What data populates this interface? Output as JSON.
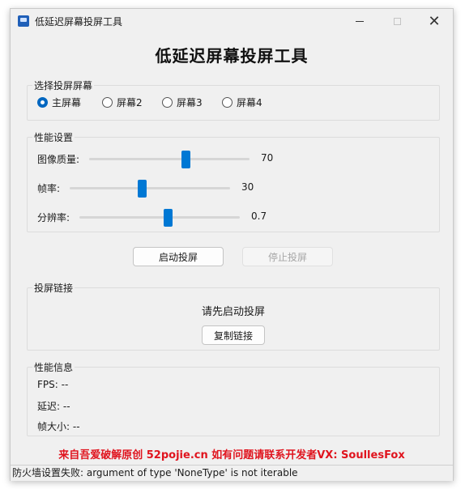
{
  "window": {
    "title": "低延迟屏幕投屏工具",
    "minimize": "—",
    "close": "✕"
  },
  "main_title": "低延迟屏幕投屏工具",
  "screen_group": {
    "title": "选择投屏屏幕",
    "options": [
      {
        "label": "主屏幕",
        "selected": true
      },
      {
        "label": "屏幕2",
        "selected": false
      },
      {
        "label": "屏幕3",
        "selected": false
      },
      {
        "label": "屏幕4",
        "selected": false
      }
    ]
  },
  "perf_group": {
    "title": "性能设置",
    "sliders": [
      {
        "label": "图像质量:",
        "value": "70",
        "fraction": 0.6
      },
      {
        "label": "帧率:",
        "value": "30",
        "fraction": 0.45
      },
      {
        "label": "分辨率:",
        "value": "0.7",
        "fraction": 0.55
      }
    ]
  },
  "buttons": {
    "start": "启动投屏",
    "stop": "停止投屏"
  },
  "link_group": {
    "title": "投屏链接",
    "status": "请先启动投屏",
    "copy_button": "复制链接"
  },
  "info_group": {
    "title": "性能信息",
    "fps": "FPS: --",
    "latency": "延迟: --",
    "frame_size": "帧大小: --"
  },
  "footer_note": "来自吾爱破解原创 52pojie.cn 如有问题请联系开发者VX: SoullesFox",
  "status_bar": "防火墙设置失败: argument of type 'NoneType' is not iterable",
  "colors": {
    "accent": "#0078d4",
    "footer_red": "#e0141e"
  }
}
